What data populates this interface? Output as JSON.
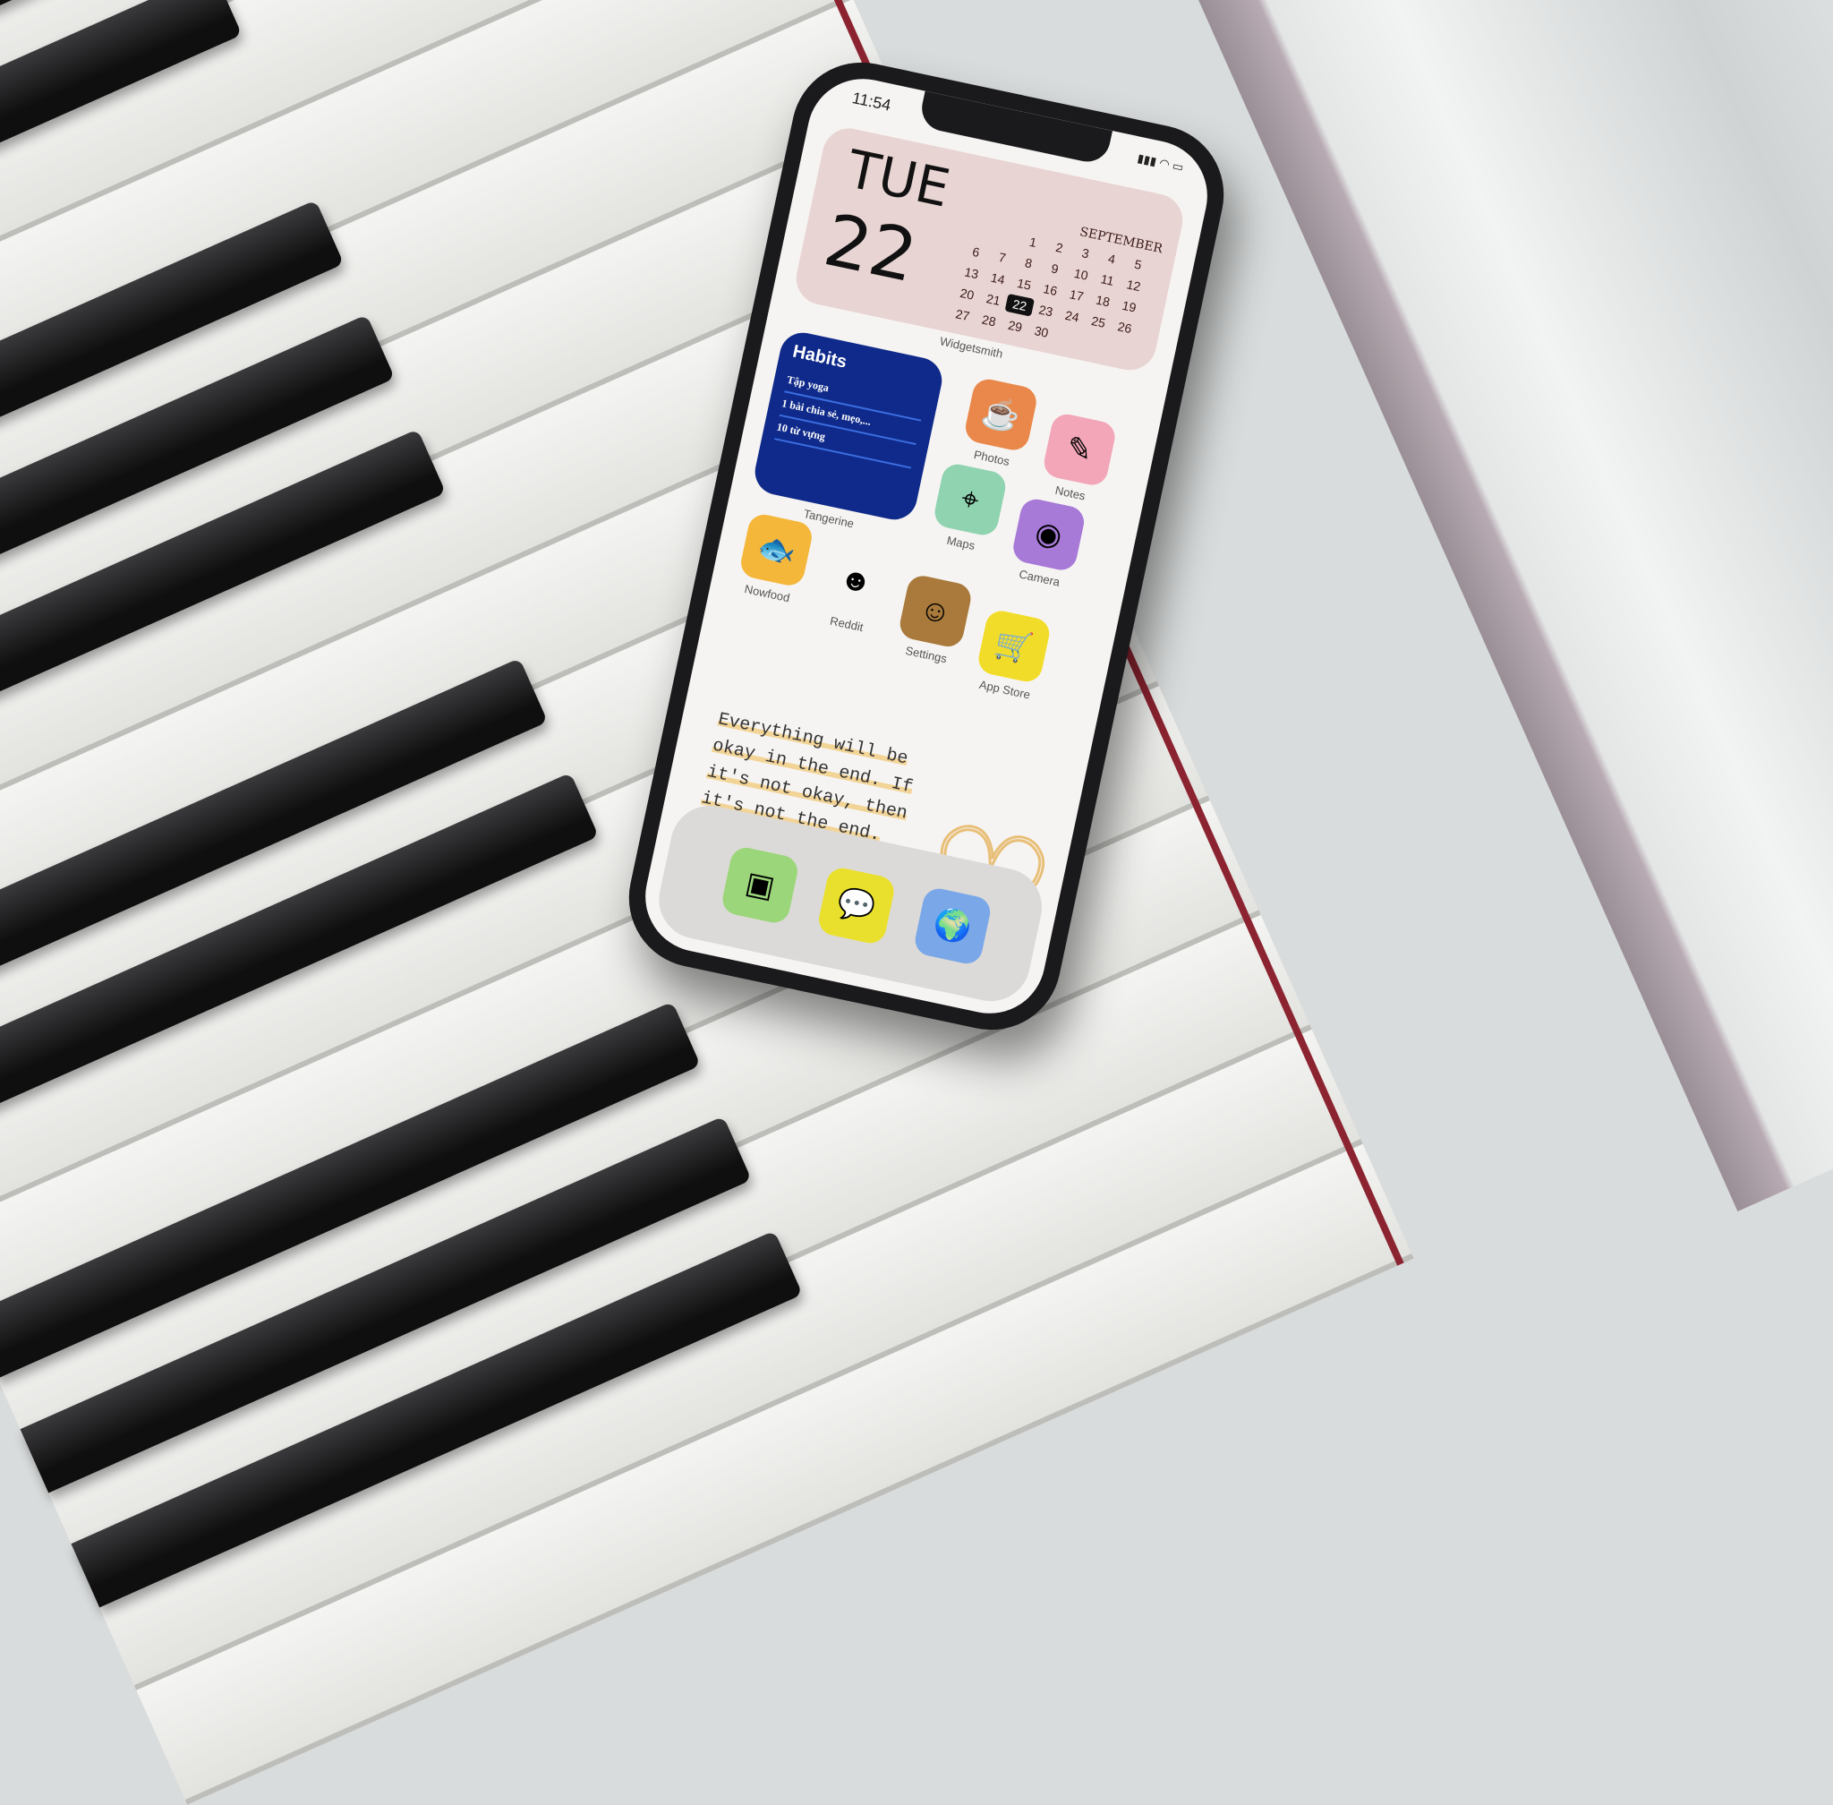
{
  "status_bar": {
    "time": "11:54",
    "icons": [
      "signal-icon",
      "wifi-icon",
      "battery-icon"
    ]
  },
  "calendar_widget": {
    "weekday": "TUE",
    "day": "22",
    "month": "SEPTEMBER",
    "today": "22",
    "days": [
      "",
      "",
      "1",
      "2",
      "3",
      "4",
      "5",
      "6",
      "7",
      "8",
      "9",
      "10",
      "11",
      "12",
      "13",
      "14",
      "15",
      "16",
      "17",
      "18",
      "19",
      "20",
      "21",
      "22",
      "23",
      "24",
      "25",
      "26",
      "27",
      "28",
      "29",
      "30"
    ],
    "app_label": "Widgetsmith"
  },
  "habits_widget": {
    "title": "Habits",
    "items": [
      "Tập yoga",
      "1 bài chia sẻ, mẹo,...",
      "10 từ vựng"
    ],
    "app_label": "Tangerine"
  },
  "apps": [
    {
      "label": "Photos",
      "icon": "photos-icon",
      "color": "#e9884a"
    },
    {
      "label": "Notes",
      "icon": "notes-icon",
      "color": "#f2a6b8"
    },
    {
      "label": "Maps",
      "icon": "maps-icon",
      "color": "#8fd3b0"
    },
    {
      "label": "Camera",
      "icon": "camera-icon",
      "color": "#a77ad8"
    },
    {
      "label": "Nowfood",
      "icon": "nowfood-icon",
      "color": "#f4b73a"
    },
    {
      "label": "Reddit",
      "icon": "reddit-icon",
      "color": "#f6f4f2"
    },
    {
      "label": "Settings",
      "icon": "settings-icon",
      "color": "#a97a3c"
    },
    {
      "label": "App Store",
      "icon": "app-store-icon",
      "color": "#f2dc2a"
    }
  ],
  "quote": "Everything will be okay in the end. If it's not okay, then it's not the end.",
  "dock": [
    {
      "icon": "book-icon",
      "color": "#9bd67a"
    },
    {
      "icon": "messages-icon",
      "color": "#e9e02e"
    },
    {
      "icon": "globe-icon",
      "color": "#7aa7e8"
    }
  ]
}
